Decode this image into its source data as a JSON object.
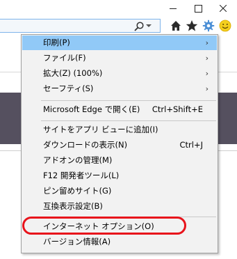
{
  "window_controls": {
    "minimize": "minimize",
    "maximize": "maximize",
    "close": "close"
  },
  "toolbar": {
    "icons": [
      "search-icon",
      "home-icon",
      "favorites-star-icon",
      "tools-gear-icon",
      "feedback-smiley-icon"
    ]
  },
  "menu": {
    "items": [
      {
        "label": "印刷(P)",
        "shortcut": "",
        "submenu": true
      },
      {
        "label": "ファイル(F)",
        "shortcut": "",
        "submenu": true
      },
      {
        "label": "拡大(Z) (100%)",
        "shortcut": "",
        "submenu": true
      },
      {
        "label": "セーフティ(S)",
        "shortcut": "",
        "submenu": true
      },
      {
        "label": "Microsoft Edge で開く(E)",
        "shortcut": "Ctrl+Shift+E",
        "submenu": false
      },
      {
        "label": "サイトをアプリ ビューに追加(I)",
        "shortcut": "",
        "submenu": false
      },
      {
        "label": "ダウンロードの表示(N)",
        "shortcut": "Ctrl+J",
        "submenu": false
      },
      {
        "label": "アドオンの管理(M)",
        "shortcut": "",
        "submenu": false
      },
      {
        "label": "F12 開発者ツール(L)",
        "shortcut": "",
        "submenu": false
      },
      {
        "label": "ピン留めサイト(G)",
        "shortcut": "",
        "submenu": false
      },
      {
        "label": "互換表示設定(B)",
        "shortcut": "",
        "submenu": false
      },
      {
        "label": "インターネット オプション(O)",
        "shortcut": "",
        "submenu": false
      },
      {
        "label": "バージョン情報(A)",
        "shortcut": "",
        "submenu": false
      }
    ],
    "submenu_arrow": "›"
  },
  "colors": {
    "highlight": "#91c9f7",
    "annotation": "#e8131b",
    "menu_background": "#f2f2f2"
  }
}
